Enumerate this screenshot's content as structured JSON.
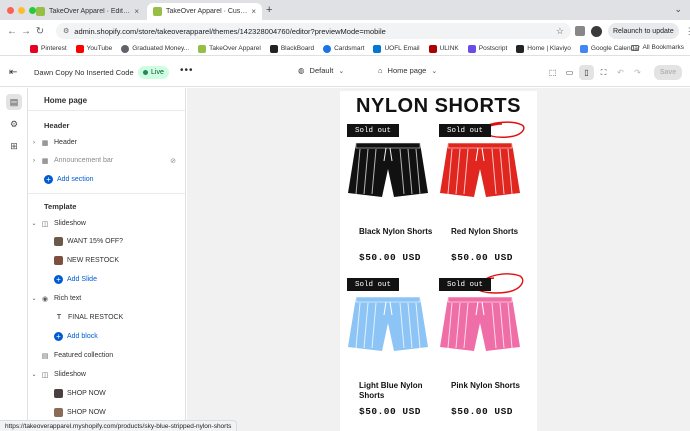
{
  "browser": {
    "tabs": [
      {
        "title": "TakeOver Apparel · Edit ~ Dawn",
        "active": false
      },
      {
        "title": "TakeOver Apparel · Customize",
        "active": true
      }
    ],
    "url": "admin.shopify.com/store/takeoverapparel/themes/142328004760/editor?previewMode=mobile",
    "relaunch_label": "Relaunch to update",
    "bookmarks": [
      {
        "label": "Pinterest",
        "color": "#e60023"
      },
      {
        "label": "YouTube",
        "color": "#ff0000"
      },
      {
        "label": "Graduated Money...",
        "color": "#5f6368"
      },
      {
        "label": "TakeOver Apparel",
        "color": "#95bf47"
      },
      {
        "label": "BlackBoard",
        "color": "#222222"
      },
      {
        "label": "Cardsmart",
        "color": "#1a73e8"
      },
      {
        "label": "UOFL Email",
        "color": "#0078d4"
      },
      {
        "label": "ULINK",
        "color": "#ad0000"
      },
      {
        "label": "Postscript",
        "color": "#6b4ce6"
      },
      {
        "label": "Home | Klaviyo",
        "color": "#232426"
      },
      {
        "label": "Google Calendar",
        "color": "#4285f4"
      }
    ],
    "all_bookmarks_label": "All Bookmarks",
    "status_url": "https://takeoverapparel.myshopify.com/products/sky-blue-stripped-nylon-shorts"
  },
  "editor": {
    "theme_name": "Dawn Copy No Inserted Code",
    "status_badge": "Live",
    "theme_selector": "Default",
    "page_selector": "Home page",
    "save_label": "Save"
  },
  "sidebar": {
    "title": "Home page",
    "header_group": "Header",
    "header_items": [
      {
        "label": "Header",
        "dim": false
      },
      {
        "label": "Announcement bar",
        "dim": true
      }
    ],
    "add_section": "Add section",
    "template_group": "Template",
    "sections": [
      {
        "label": "Slideshow",
        "type": "section"
      },
      {
        "label": "WANT 15% OFF?",
        "type": "block"
      },
      {
        "label": "NEW RESTOCK",
        "type": "block"
      },
      {
        "label": "Add Slide",
        "type": "add"
      },
      {
        "label": "Rich text",
        "type": "section"
      },
      {
        "label": "FINAL RESTOCK",
        "type": "block"
      },
      {
        "label": "Add block",
        "type": "add"
      },
      {
        "label": "Featured collection",
        "type": "section"
      },
      {
        "label": "Slideshow",
        "type": "section"
      },
      {
        "label": "SHOP NOW",
        "type": "block"
      },
      {
        "label": "SHOP NOW",
        "type": "block"
      }
    ]
  },
  "preview": {
    "collection_title": "NYLON SHORTS",
    "products": [
      {
        "name": "Black Nylon Shorts",
        "price": "$50.00 USD",
        "badge": "Sold out",
        "color": "#111111",
        "stripe": "#eeeeee"
      },
      {
        "name": "Red Nylon Shorts",
        "price": "$50.00 USD",
        "badge": "Sold out",
        "color": "#e0261e",
        "stripe": "#ffffff"
      },
      {
        "name": "Light Blue Nylon Shorts",
        "price": "$50.00 USD",
        "badge": "Sold out",
        "color": "#8cc4f5",
        "stripe": "#ffffff"
      },
      {
        "name": "Pink Nylon Shorts",
        "price": "$50.00 USD",
        "badge": "Sold out",
        "color": "#f06ea8",
        "stripe": "#ffffff"
      }
    ],
    "annotation_color": "#e01010"
  }
}
